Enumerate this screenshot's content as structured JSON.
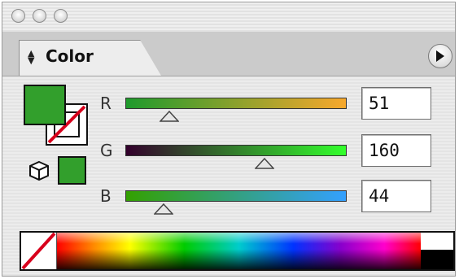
{
  "window": {
    "buttons": [
      "close",
      "minimize",
      "zoom"
    ]
  },
  "tab": {
    "label": "Color"
  },
  "fill_color": "#329f2c",
  "channels": [
    {
      "label": "R",
      "value": "51",
      "fraction": 0.2,
      "track_from": "#1e9a2c",
      "track_to": "#f8a82c"
    },
    {
      "label": "G",
      "value": "160",
      "fraction": 0.627,
      "track_from": "#33002c",
      "track_to": "#33ff2c"
    },
    {
      "label": "B",
      "value": "44",
      "fraction": 0.173,
      "track_from": "#33a000",
      "track_to": "#33a0ff"
    }
  ],
  "icons": {
    "panel_menu": "right-arrow-circle-icon",
    "stepper": "up-down-arrows-icon",
    "web_safe": "cube-icon",
    "none_swatch": "red-slash-icon"
  }
}
